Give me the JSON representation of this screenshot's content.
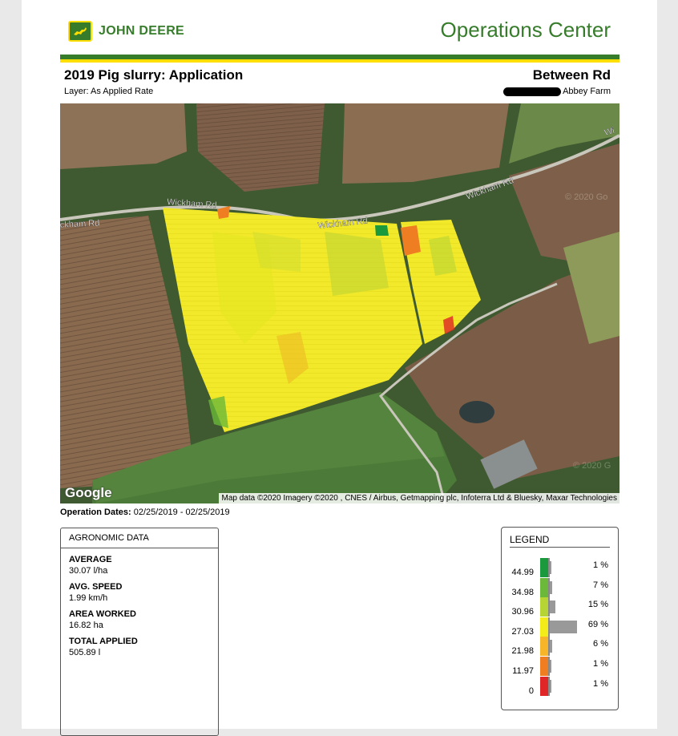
{
  "header": {
    "brand": "JOHN DEERE",
    "app_title": "Operations Center"
  },
  "report": {
    "title": "2019 Pig slurry: Application",
    "layer": "Layer: As Applied Rate",
    "field": "Between Rd",
    "farm": "Abbey Farm"
  },
  "map": {
    "road_labels": [
      "Wickham Rd",
      "Wickham Rd",
      "Wickham Rd",
      "ckham Rd",
      "Wi"
    ],
    "watermark": "Google",
    "attribution": "Map data ©2020 Imagery ©2020 , CNES / Airbus, Getmapping plc, Infoterra Ltd & Bluesky, Maxar Technologies",
    "faint_marks": [
      "© 2020 Go",
      "© 2020 G"
    ]
  },
  "operation": {
    "label": "Operation Dates:",
    "value": "02/25/2019 - 02/25/2019"
  },
  "agronomic": {
    "heading": "AGRONOMIC DATA",
    "items": [
      {
        "label": "AVERAGE",
        "value": "30.07 l/ha"
      },
      {
        "label": "AVG. SPEED",
        "value": "1.99 km/h"
      },
      {
        "label": "AREA WORKED",
        "value": "16.82 ha"
      },
      {
        "label": "TOTAL APPLIED",
        "value": "505.89 l"
      }
    ]
  },
  "legend": {
    "heading": "LEGEND",
    "rows": [
      {
        "value": "44.99",
        "color": "#1a9a3c",
        "percent_label": "1 %",
        "percent": 1
      },
      {
        "value": "34.98",
        "color": "#6cb83a",
        "percent_label": "7 %",
        "percent": 7
      },
      {
        "value": "30.96",
        "color": "#b6d433",
        "percent_label": "15 %",
        "percent": 15
      },
      {
        "value": "27.03",
        "color": "#f4ec19",
        "percent_label": "69 %",
        "percent": 69
      },
      {
        "value": "21.98",
        "color": "#f7b52a",
        "percent_label": "6 %",
        "percent": 6
      },
      {
        "value": "11.97",
        "color": "#ef7d22",
        "percent_label": "1 %",
        "percent": 1
      },
      {
        "value": "0",
        "color": "#e02626",
        "percent_label": "1 %",
        "percent": 1
      }
    ]
  },
  "colors": {
    "brand_green": "#367c2b",
    "brand_yellow": "#ffde00"
  }
}
